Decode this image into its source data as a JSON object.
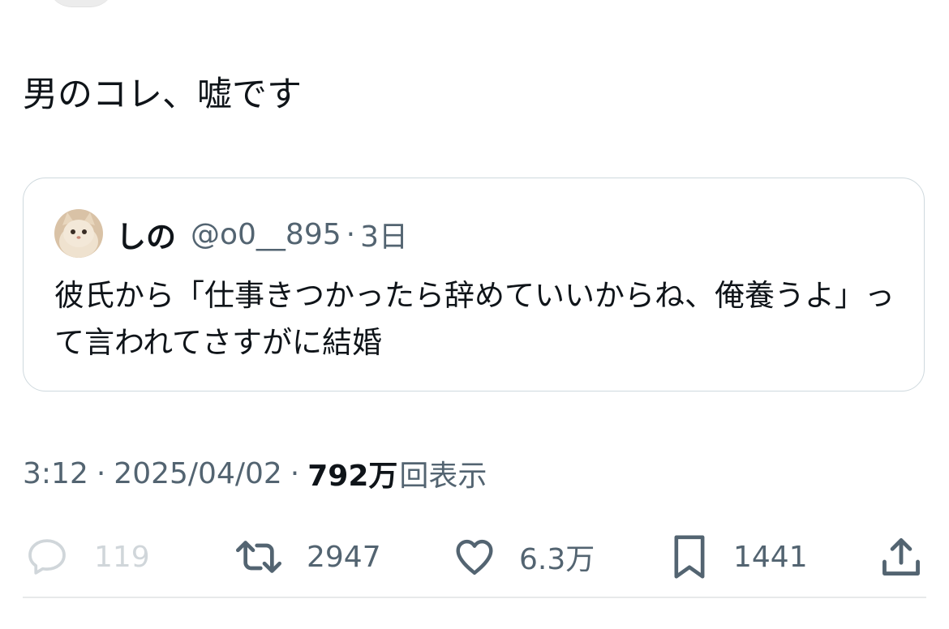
{
  "tweet": {
    "text": "男のコレ、嘘です"
  },
  "quote": {
    "name": "しの",
    "handle": "@o0__895",
    "separator": "·",
    "time": "3日",
    "text": "彼氏から「仕事きつかったら辞めていいからね、俺養うよ」って言われてさすがに結婚"
  },
  "meta": {
    "time": "3:12",
    "separator": "·",
    "date": "2025/04/02",
    "views_count": "792万",
    "views_label": "回表示"
  },
  "actions": {
    "reply": {
      "icon": "reply-icon",
      "count": "119"
    },
    "retweet": {
      "icon": "retweet-icon",
      "count": "2947"
    },
    "like": {
      "icon": "heart-icon",
      "count": "6.3万"
    },
    "bookmark": {
      "icon": "bookmark-icon",
      "count": "1441"
    },
    "share": {
      "icon": "share-icon"
    }
  },
  "colors": {
    "text_primary": "#0f1419",
    "text_secondary": "#536471",
    "border": "#cfd9de",
    "disabled": "#d0d6da"
  }
}
